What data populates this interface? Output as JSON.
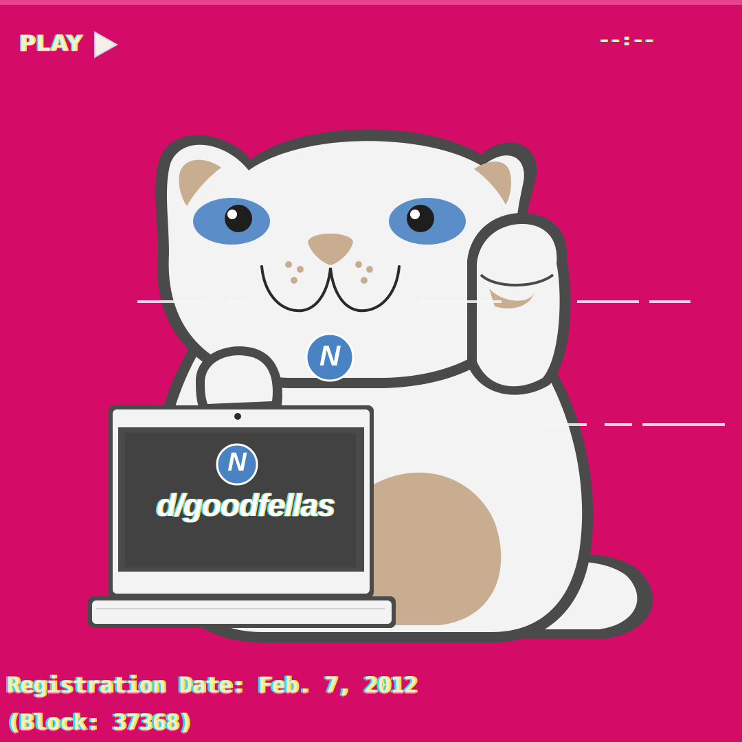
{
  "overlay": {
    "play_label": "PLAY",
    "timecode": "--:--"
  },
  "laptop": {
    "domain_name": "d/goodfellas",
    "logo_glyph": "N"
  },
  "collar": {
    "logo_glyph": "N"
  },
  "registration": {
    "date_line": "Registration Date: Feb. 7, 2012",
    "block_line": "(Block: 37368)"
  },
  "colors": {
    "background": "#d40c68",
    "cat_body": "#f3f3f3",
    "outline": "#4a4a4a",
    "eyes": "#5b8ec8",
    "tan": "#c8ad90",
    "namecoin_blue": "#4a83c3",
    "screen": "#424242",
    "vhs_text": "#f3efbd"
  },
  "icons": [
    "play-triangle-icon",
    "namecoin-logo-icon"
  ]
}
